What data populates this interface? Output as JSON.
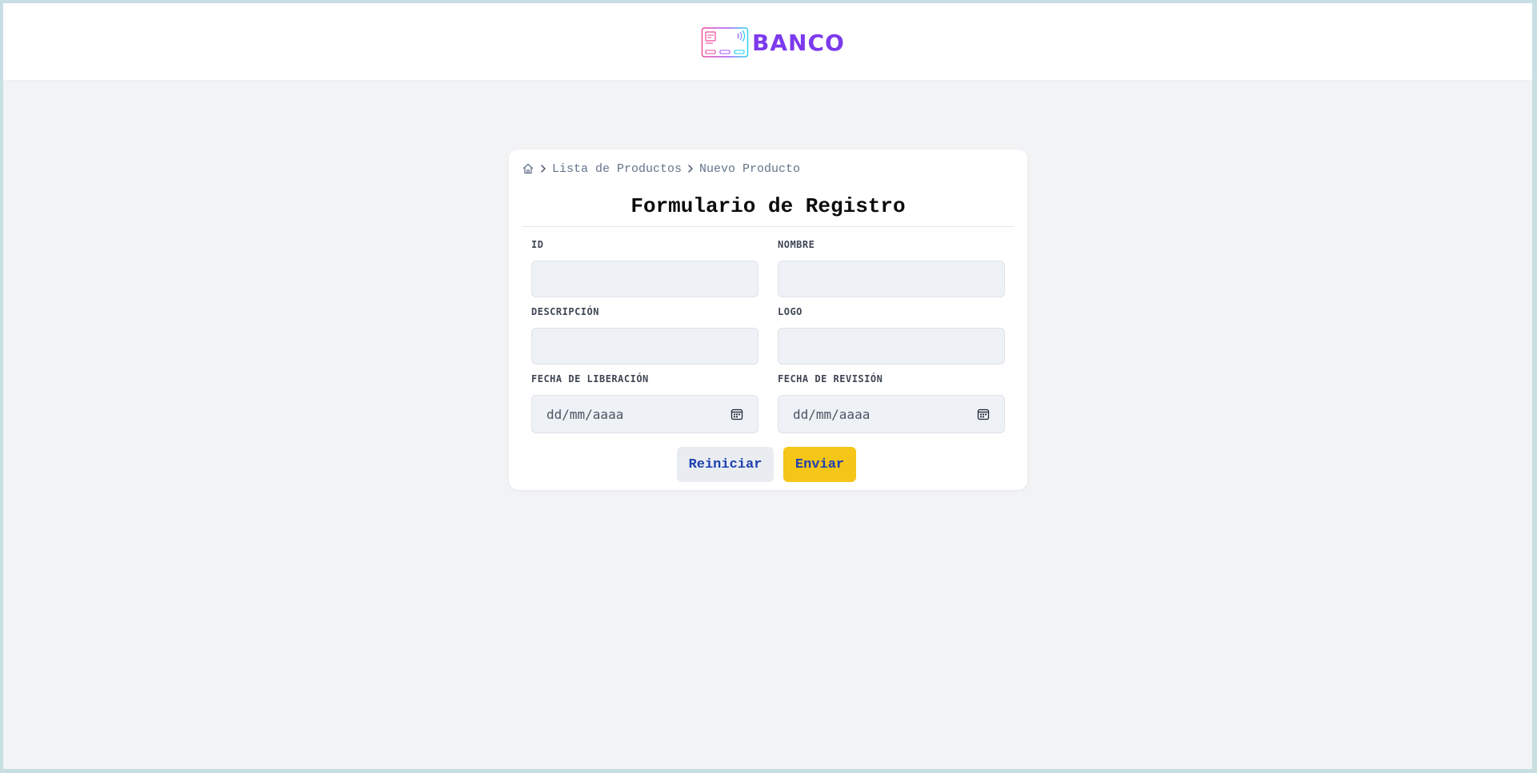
{
  "header": {
    "brand_name": "BANCO",
    "logo_icon": "credit-card-contactless-icon",
    "brand_color": "#7c3aed"
  },
  "breadcrumb": {
    "home_icon": "home-icon",
    "separator_icon": "chevron-right-icon",
    "items": [
      "Lista de Productos",
      "Nuevo Producto"
    ]
  },
  "form": {
    "title": "Formulario de Registro",
    "fields": {
      "id": {
        "label": "ID",
        "value": "",
        "placeholder": ""
      },
      "nombre": {
        "label": "NOMBRE",
        "value": "",
        "placeholder": ""
      },
      "descripcion": {
        "label": "DESCRIPCIÓN",
        "value": "",
        "placeholder": ""
      },
      "logo": {
        "label": "LOGO",
        "value": "",
        "placeholder": ""
      },
      "fecha_liberacion": {
        "label": "FECHA DE LIBERACIÓN",
        "value": "dd/mm/aaaa",
        "icon": "calendar-icon"
      },
      "fecha_revision": {
        "label": "FECHA DE REVISIÓN",
        "value": "dd/mm/aaaa",
        "icon": "calendar-icon"
      }
    },
    "buttons": {
      "reset_label": "Reiniciar",
      "submit_label": "Enviar"
    }
  },
  "colors": {
    "page_background": "#f2f3f5",
    "card_background": "#ffffff",
    "input_background": "#eef1f5",
    "button_text": "#1e40af",
    "submit_button": "#f5c518",
    "reset_button": "#e9edf2"
  }
}
